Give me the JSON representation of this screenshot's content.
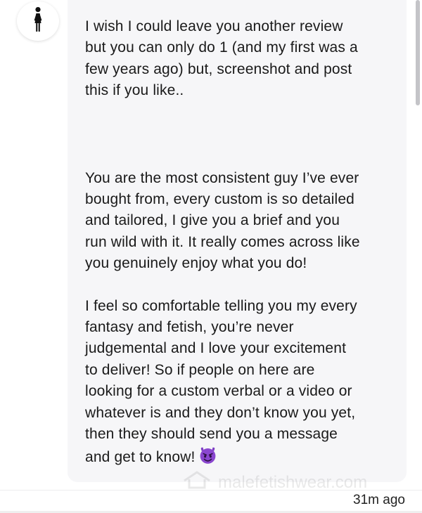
{
  "sender": {
    "avatar_icon": "person-dress-icon"
  },
  "message": {
    "paragraphs": [
      "I wish I could leave you another review\nbut you can only do 1 (and my first was a\nfew years ago) but, screenshot and post\nthis if you like..",
      "You are the most consistent guy I’ve ever\nbought from, every custom is so detailed\nand tailored, I give you a brief and you\nrun wild with it. It really comes across like\nyou genuinely enjoy what you do!",
      "I feel so comfortable telling you my every\nfantasy and fetish, you’re never\njudgemental and I love your excitement\nto deliver! So if people on here are\nlooking for a custom verbal or a video or\nwhatever is and they don’t know you yet,\nthen they should send you a message\nand get to know!"
    ],
    "emoji_icon": "smiling-devil-emoji-icon",
    "bubble_color": "#f6f6f8",
    "timestamp": "31m ago"
  },
  "watermark": {
    "text": "malefetishwear.com"
  }
}
